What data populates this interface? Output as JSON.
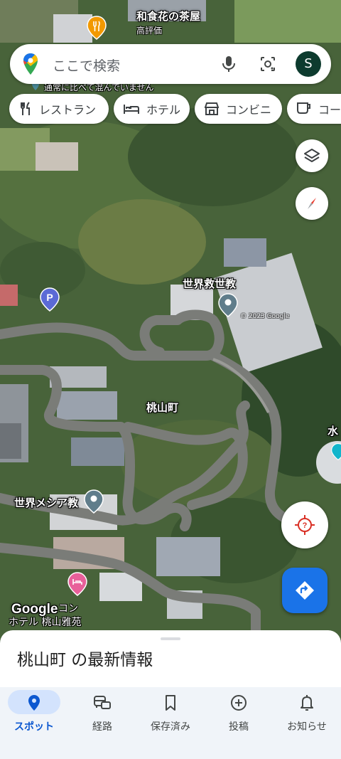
{
  "map": {
    "labels": {
      "restaurant": "和食花の茶屋",
      "restaurant_price": "高評価",
      "traffic_note": "通常に比べて混んでいません",
      "religious_1": "世界救世教",
      "town": "桃山町",
      "religious_2": "世界メシア教",
      "partial_right": "水",
      "hotel_partial": "コン",
      "hotel": "ホテル 桃山雅苑",
      "watermark_text": "© 2023 Google"
    },
    "logo": "Google"
  },
  "search": {
    "placeholder": "ここで検索",
    "avatar_letter": "S"
  },
  "chips": [
    {
      "label": "レストラン",
      "icon": "fork-knife-icon"
    },
    {
      "label": "ホテル",
      "icon": "bed-icon"
    },
    {
      "label": "コンビニ",
      "icon": "store-icon"
    },
    {
      "label": "コーヒー",
      "icon": "coffee-icon"
    }
  ],
  "sheet": {
    "title": "桃山町 の最新情報"
  },
  "nav": [
    {
      "label": "スポット",
      "icon": "location-pin-icon",
      "active": true
    },
    {
      "label": "経路",
      "icon": "commute-icon",
      "active": false
    },
    {
      "label": "保存済み",
      "icon": "bookmark-icon",
      "active": false
    },
    {
      "label": "投稿",
      "icon": "add-circle-icon",
      "active": false
    },
    {
      "label": "お知らせ",
      "icon": "bell-icon",
      "active": false
    }
  ],
  "colors": {
    "accent": "#1a73e8",
    "active_pill": "#d3e3fd",
    "nav_bg": "#f0f4f9"
  }
}
